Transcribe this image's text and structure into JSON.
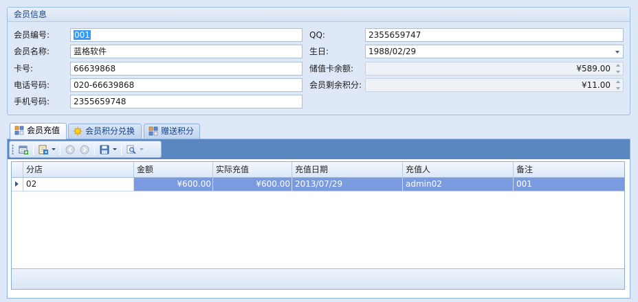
{
  "member_info": {
    "title": "会员信息",
    "labels": {
      "member_no": "会员编号:",
      "member_name": "会员名称:",
      "card_no": "卡号:",
      "phone": "电话号码:",
      "mobile": "手机号码:",
      "qq": "QQ:",
      "birthday": "生日:",
      "balance": "储值卡余额:",
      "points": "会员剩余积分:"
    },
    "values": {
      "member_no": "001",
      "member_name": "蓝格软件",
      "card_no": "66639868",
      "phone": "020-66639868",
      "mobile": "2355659748",
      "qq": "2355659747",
      "birthday": "1988/02/29",
      "balance": "¥589.00",
      "points": "¥11.00"
    }
  },
  "tabs": [
    {
      "label": "会员充值",
      "icon": "recharge-icon",
      "active": true
    },
    {
      "label": "会员积分兑换",
      "icon": "exchange-icon",
      "active": false
    },
    {
      "label": "赠送积分",
      "icon": "gift-points-icon",
      "active": false
    }
  ],
  "toolbar": {
    "icons": [
      "add-icon",
      "export-icon",
      "previous-icon",
      "next-icon",
      "save-icon",
      "search-icon"
    ]
  },
  "grid": {
    "columns": [
      "分店",
      "金额",
      "实际充值",
      "充值日期",
      "充值人",
      "备注"
    ],
    "rows": [
      {
        "branch": "02",
        "amount": "¥600.00",
        "actual": "¥600.00",
        "date": "2013/07/29",
        "operator": "admin02",
        "note": "001"
      }
    ]
  },
  "colors": {
    "background": "#dfe8f6",
    "toolbar_band": "#5b87c0",
    "row_highlight": "#7b9be0",
    "title_text": "#15428b"
  }
}
